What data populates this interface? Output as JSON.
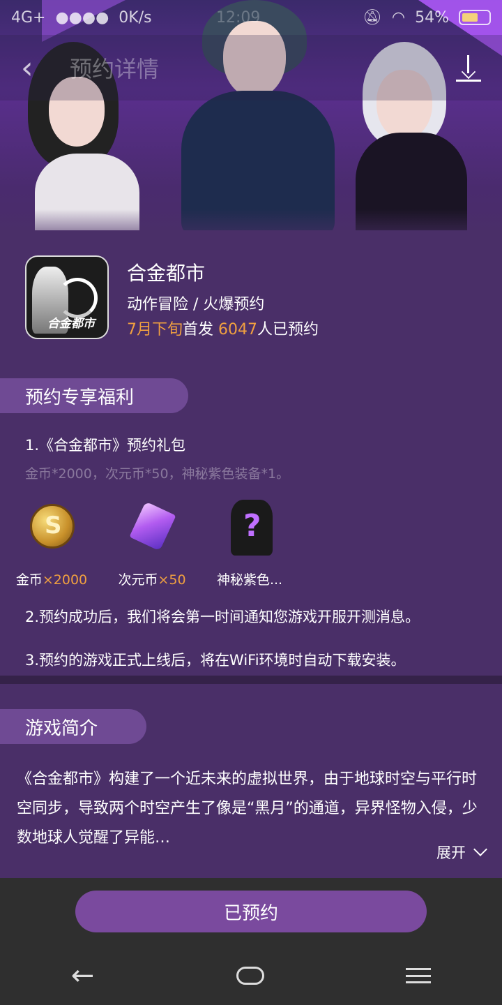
{
  "status_bar": {
    "network": "4G+",
    "speed": "0K/s",
    "time": "12:09",
    "battery_percent": "54%"
  },
  "nav": {
    "title": "预约详情"
  },
  "app": {
    "name": "合金都市",
    "category": "动作冒险 / 火爆预约",
    "release_prefix": "7月下旬",
    "release_middle": "首发 ",
    "reserve_count": "6047",
    "reserve_suffix": "人已预约",
    "icon_text": "合金都市"
  },
  "benefits": {
    "section_title": "预约专享福利",
    "gift_title": "1.《合金都市》预约礼包",
    "gift_desc": "金币*2000，次元币*50，神秘紫色装备*1。",
    "items": [
      {
        "name": "金币",
        "qty": "×2000"
      },
      {
        "name": "次元币",
        "qty": "×50"
      },
      {
        "name": "神秘紫色...",
        "qty": ""
      }
    ],
    "line2": "2.预约成功后，我们将会第一时间通知您游戏开服开测消息。",
    "line3": "3.预约的游戏正式上线后，将在WiFi环境时自动下载安装。"
  },
  "intro": {
    "section_title": "游戏简介",
    "text": "《合金都市》构建了一个近未来的虚拟世界，由于地球时空与平行时空同步，导致两个时空产生了像是“黑月”的通道，异界怪物入侵，少数地球人觉醒了异能…",
    "expand_label": "展开"
  },
  "action": {
    "reserved_label": "已预约"
  },
  "colors": {
    "accent_orange": "#f0a040",
    "content_bg": "#4a2f68",
    "button_purple": "#7a4a9e"
  }
}
